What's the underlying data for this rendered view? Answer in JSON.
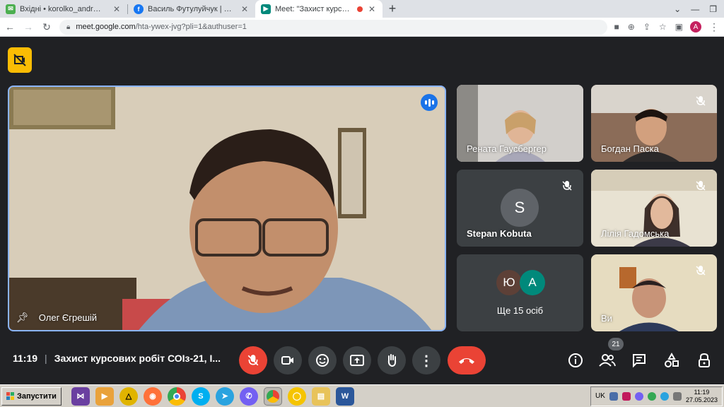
{
  "browser": {
    "tabs": [
      {
        "title": "Вхідні • korolko_andr@ukr.net",
        "icon": "mail-icon",
        "color": "#4caf50"
      },
      {
        "title": "Василь Футулуйчук | Facebook",
        "icon": "facebook-icon",
        "color": "#1877f2"
      },
      {
        "title": "Meet: \"Захист курсових робі",
        "icon": "meet-icon",
        "color": "#00897b"
      }
    ],
    "new_tab": "+",
    "url_host": "meet.google.com",
    "url_path": "/hta-ywex-jvg?pli=1&authuser=1",
    "profile_initial": "A"
  },
  "meet": {
    "main_speaker": "Олег Єгрешій",
    "participants": [
      {
        "name": "Рената Гаусбергер"
      },
      {
        "name": "Богдан Паска"
      },
      {
        "name": "Stepan Kobuta",
        "initial": "S"
      },
      {
        "name": "Лілія Гадомська"
      },
      {
        "name": "Ще 15 осіб",
        "initials": [
          "Ю",
          "А"
        ]
      },
      {
        "name": "Ви"
      }
    ],
    "time": "11:19",
    "meeting_title": "Захист курсових робіт СОІз-21, І...",
    "participant_count": "21",
    "colors": {
      "accent": "#8ab4f8",
      "danger": "#ea4335",
      "bg": "#202124",
      "badge": "#fbbc04"
    }
  },
  "taskbar": {
    "start_label": "Запустити",
    "lang": "UK",
    "clock_time": "11:19",
    "clock_date": "27.05.2023"
  }
}
